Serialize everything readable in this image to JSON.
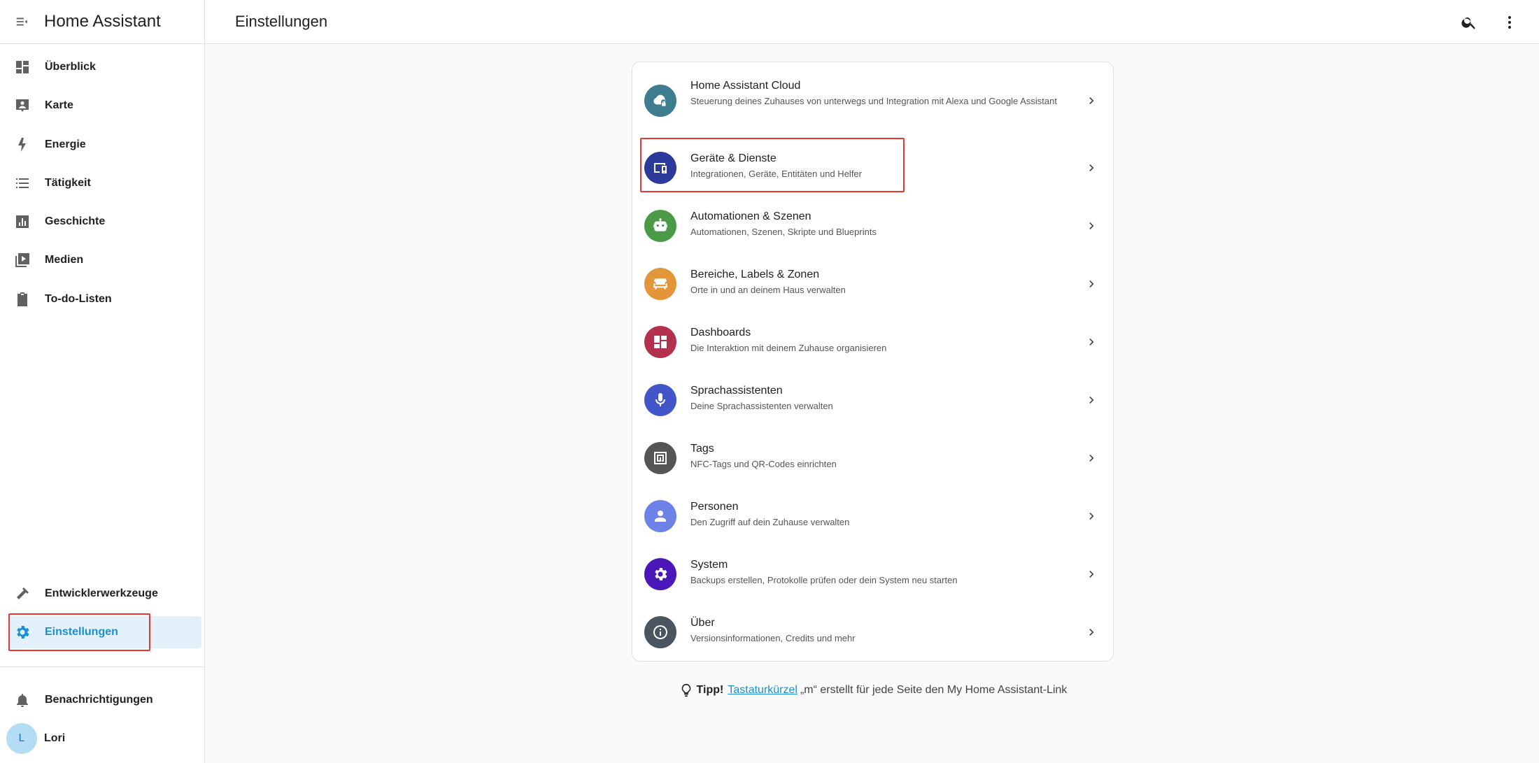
{
  "sidebar": {
    "title": "Home Assistant",
    "items": [
      {
        "label": "Überblick",
        "icon": "dashboard-icon"
      },
      {
        "label": "Karte",
        "icon": "map-icon"
      },
      {
        "label": "Energie",
        "icon": "lightning-icon"
      },
      {
        "label": "Tätigkeit",
        "icon": "list-icon"
      },
      {
        "label": "Geschichte",
        "icon": "chart-icon"
      },
      {
        "label": "Medien",
        "icon": "media-icon"
      },
      {
        "label": "To-do-Listen",
        "icon": "clipboard-icon"
      }
    ],
    "bottom_items": [
      {
        "label": "Entwicklerwerkzeuge",
        "icon": "hammer-icon"
      },
      {
        "label": "Einstellungen",
        "icon": "gear-icon"
      }
    ],
    "notifications_label": "Benachrichtigungen",
    "user": {
      "name": "Lori",
      "initial": "L"
    }
  },
  "header": {
    "title": "Einstellungen"
  },
  "settings": [
    {
      "title": "Home Assistant Cloud",
      "subtitle": "Steuerung deines Zuhauses von unterwegs und Integration mit Alexa und Google Assistant",
      "color": "#3e7d8f"
    },
    {
      "title": "Geräte & Dienste",
      "subtitle": "Integrationen, Geräte, Entitäten und Helfer",
      "color": "#2b3a9b"
    },
    {
      "title": "Automationen & Szenen",
      "subtitle": "Automationen, Szenen, Skripte und Blueprints",
      "color": "#4b9a47"
    },
    {
      "title": "Bereiche, Labels & Zonen",
      "subtitle": "Orte in und an deinem Haus verwalten",
      "color": "#e3953a"
    },
    {
      "title": "Dashboards",
      "subtitle": "Die Interaktion mit deinem Zuhause organisieren",
      "color": "#b4304f"
    },
    {
      "title": "Sprachassistenten",
      "subtitle": "Deine Sprachassistenten verwalten",
      "color": "#4256c9"
    },
    {
      "title": "Tags",
      "subtitle": "NFC-Tags und QR-Codes einrichten",
      "color": "#555555"
    },
    {
      "title": "Personen",
      "subtitle": "Den Zugriff auf dein Zuhause verwalten",
      "color": "#6c82e6"
    },
    {
      "title": "System",
      "subtitle": "Backups erstellen, Protokolle prüfen oder dein System neu starten",
      "color": "#4a17b8"
    },
    {
      "title": "Über",
      "subtitle": "Versionsinformationen, Credits und mehr",
      "color": "#4b5560"
    }
  ],
  "tip": {
    "prefix": "Tipp!",
    "link": "Tastaturkürzel",
    "suffix": "„m“ erstellt für jede Seite den My Home Assistant-Link"
  }
}
